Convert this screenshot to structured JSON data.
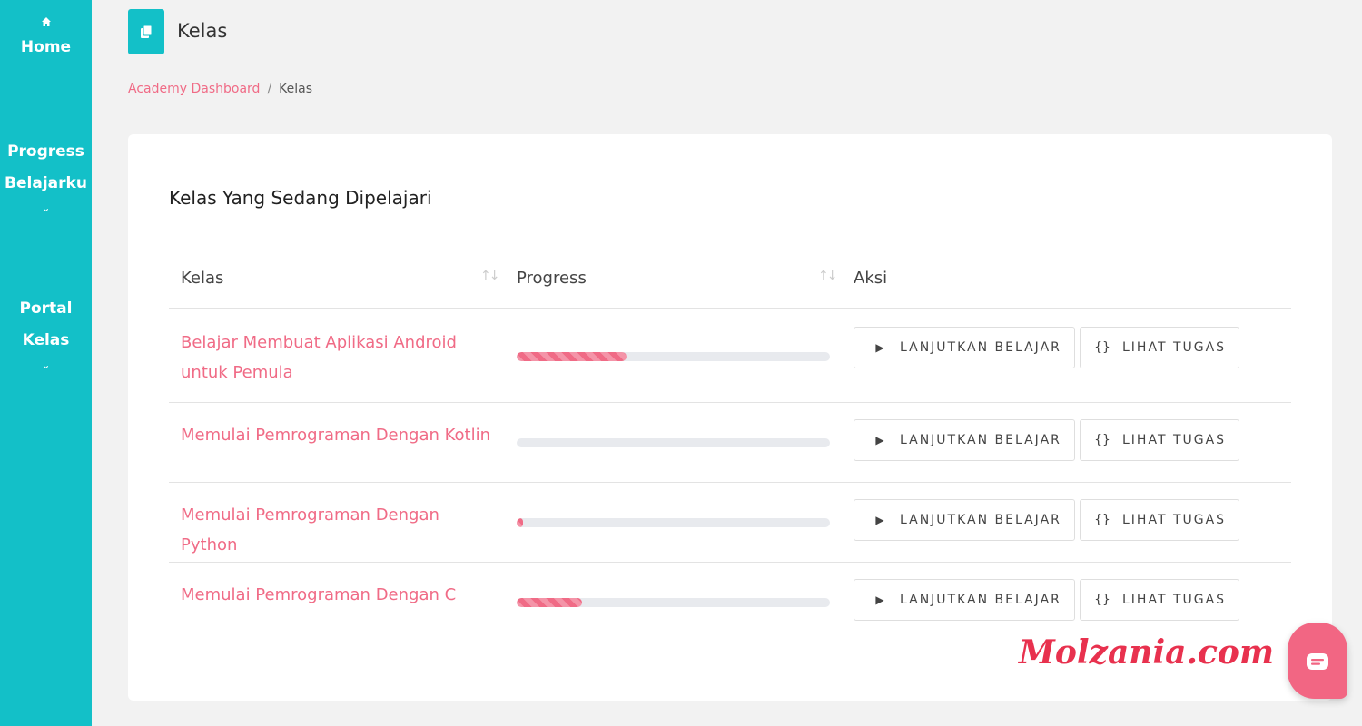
{
  "sidebar": {
    "items": [
      {
        "icon": "home-icon",
        "icon_glyph": "⌂",
        "label": "Home"
      },
      {
        "label_line1": "Progress",
        "label_line2": "Belajarku",
        "chevron": "⌄"
      },
      {
        "label_line1": "Portal",
        "label_line2": "Kelas",
        "chevron": "⌄"
      }
    ],
    "color": "#13c0c8"
  },
  "header": {
    "title": "Kelas",
    "icon": "book-icon"
  },
  "breadcrumb": {
    "items": [
      "Academy Dashboard",
      "Kelas"
    ],
    "separator": "/"
  },
  "card": {
    "title": "Kelas Yang Sedang Dipelajari",
    "table": {
      "columns": [
        "Kelas",
        "Progress",
        "Aksi"
      ],
      "rows": [
        {
          "course": "Belajar Membuat Aplikasi Android untuk Pemula",
          "progress": 0.35,
          "continue_label": "LANJUTKAN BELAJAR",
          "tasks_label": "LIHAT TUGAS"
        },
        {
          "course": "Memulai Pemrograman Dengan Kotlin",
          "progress": 0.0,
          "continue_label": "LANJUTKAN BELAJAR",
          "tasks_label": "LIHAT TUGAS"
        },
        {
          "course": "Memulai Pemrograman Dengan Python",
          "progress": 0.02,
          "continue_label": "LANJUTKAN BELAJAR",
          "tasks_label": "LIHAT TUGAS"
        },
        {
          "course": "Memulai Pemrograman Dengan C",
          "progress": 0.21,
          "continue_label": "LANJUTKAN BELAJAR",
          "tasks_label": "LIHAT TUGAS"
        }
      ]
    }
  },
  "icons": {
    "play": "▶",
    "braces": "{}",
    "sort": "↑↓"
  },
  "watermark": "Molzania.com",
  "colors": {
    "accent": "#f06b86",
    "teal": "#13c0c8",
    "chat": "#f26683"
  }
}
